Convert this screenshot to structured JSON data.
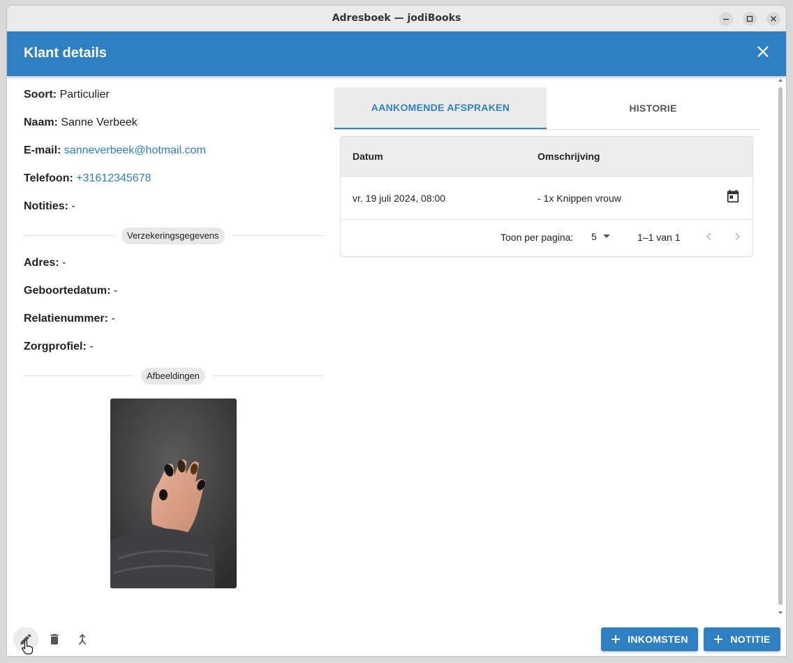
{
  "window": {
    "title": "Adresboek — jodiBooks"
  },
  "header": {
    "title": "Klant details"
  },
  "customer": {
    "soort_label": "Soort:",
    "soort": "Particulier",
    "naam_label": "Naam:",
    "naam": "Sanne Verbeek",
    "email_label": "E-mail:",
    "email": "sanneverbeek@hotmail.com",
    "telefoon_label": "Telefoon:",
    "telefoon": "+31612345678",
    "notities_label": "Notities:",
    "notities": "-"
  },
  "insurance": {
    "section_label": "Verzekeringsgegevens",
    "adres_label": "Adres:",
    "adres": "-",
    "geboortedatum_label": "Geboortedatum:",
    "geboortedatum": "-",
    "relatienummer_label": "Relatienummer:",
    "relatienummer": "-",
    "zorgprofiel_label": "Zorgprofiel:",
    "zorgprofiel": "-"
  },
  "images": {
    "section_label": "Afbeeldingen"
  },
  "tabs": [
    {
      "label": "AANKOMENDE AFSPRAKEN",
      "active": true
    },
    {
      "label": "HISTORIE",
      "active": false
    }
  ],
  "appointments": {
    "columns": [
      "Datum",
      "Omschrijving"
    ],
    "rows": [
      {
        "datum": "vr. 19 juli 2024, 08:00",
        "omschrijving": "- 1x Knippen vrouw"
      }
    ],
    "pagination": {
      "rows_per_page_label": "Toon per pagina:",
      "rows_per_page": "5",
      "range": "1–1 van 1"
    }
  },
  "footer": {
    "income_label": "INKOMSTEN",
    "note_label": "NOTITIE"
  },
  "colors": {
    "primary": "#2f80c3",
    "header_bg": "#2f80c3"
  }
}
